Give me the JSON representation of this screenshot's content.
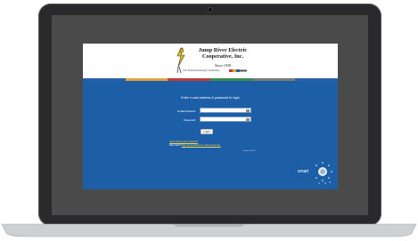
{
  "company": {
    "name_line1": "Jump River Electric",
    "name_line2": "Cooperative, Inc.",
    "since": "Since 1938",
    "tagline": "Your Touchstone Energy® Cooperative"
  },
  "login": {
    "prompt": "Enter e-mail address & password to login",
    "email_label": "E-Mail Address:",
    "password_label": "Password:",
    "login_button": "Login",
    "forgot_text": "Can't access your account?",
    "new_user_prefix": "New User?",
    "new_user_link": "Sign up to access our self service site.",
    "version": "Version 19.12"
  },
  "branding": {
    "smarthub": "smart"
  },
  "colors": {
    "screen_bg": "#1c5fa6",
    "stripe": [
      "#2b5fa8",
      "#e0a23a",
      "#c23a3a",
      "#3d8a4a",
      "#7a7a7a",
      "#2b5fa8"
    ]
  }
}
